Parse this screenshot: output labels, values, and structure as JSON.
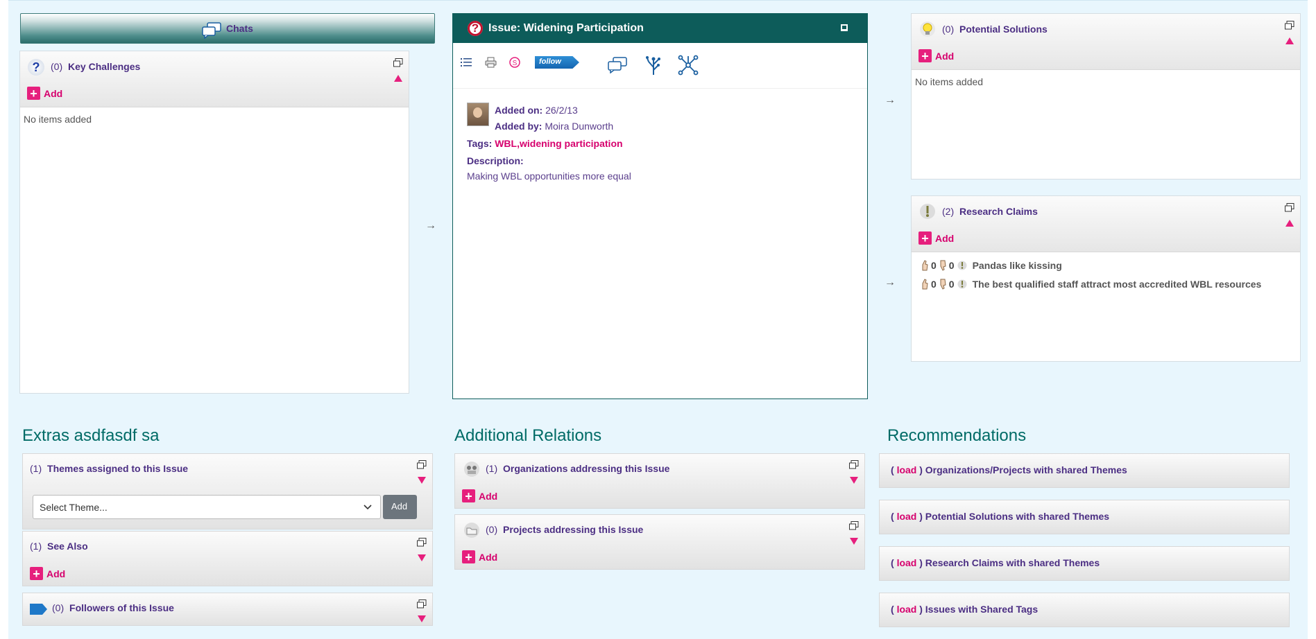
{
  "chats_button": {
    "label": "Chats"
  },
  "key_challenges": {
    "count": "(0)",
    "title": "Key Challenges",
    "add_label": "Add",
    "empty_text": "No items added"
  },
  "issue": {
    "title": "Issue: Widening Participation",
    "toolbar": {
      "follow_label": "follow"
    },
    "added_on_label": "Added on:",
    "added_on": "26/2/13",
    "added_by_label": "Added by:",
    "added_by": "Moira Dunworth",
    "tags_label": "Tags:",
    "tag1": "WBL",
    "tag_sep": ",",
    "tag2": "widening participation",
    "description_label": "Description:",
    "description": "Making WBL opportunities more equal"
  },
  "potential_solutions": {
    "count": "(0)",
    "title": "Potential Solutions",
    "add_label": "Add",
    "empty_text": "No items added"
  },
  "research_claims": {
    "count": "(2)",
    "title": "Research Claims",
    "add_label": "Add",
    "items": [
      {
        "up": "0",
        "down": "0",
        "text": "Pandas like kissing"
      },
      {
        "up": "0",
        "down": "0",
        "text": "The best qualified staff attract most accredited WBL resources"
      }
    ]
  },
  "extras": {
    "heading": "Extras asdfasdf sa",
    "themes": {
      "count": "(1)",
      "title": "Themes assigned to this Issue",
      "select_value": "Select Theme...",
      "add_label": "Add"
    },
    "see_also": {
      "count": "(1)",
      "title": "See Also",
      "add_label": "Add"
    },
    "followers": {
      "count": "(0)",
      "title": "Followers of this Issue"
    }
  },
  "additional": {
    "heading": "Additional Relations",
    "orgs": {
      "count": "(1)",
      "title": "Organizations addressing this Issue",
      "add_label": "Add"
    },
    "projects": {
      "count": "(0)",
      "title": "Projects addressing this Issue",
      "add_label": "Add"
    }
  },
  "recommendations": {
    "heading": "Recommendations",
    "open": "(",
    "load": "load",
    "close": ")",
    "items": [
      {
        "label": "Organizations/Projects with shared Themes"
      },
      {
        "label": "Potential Solutions with shared Themes"
      },
      {
        "label": "Research Claims with shared Themes"
      },
      {
        "label": "Issues with Shared Tags"
      }
    ]
  },
  "colors": {
    "accent": "#0d5c5a",
    "pink": "#e61f7d",
    "purple": "#4b2e83",
    "background": "#e8f6fd"
  }
}
